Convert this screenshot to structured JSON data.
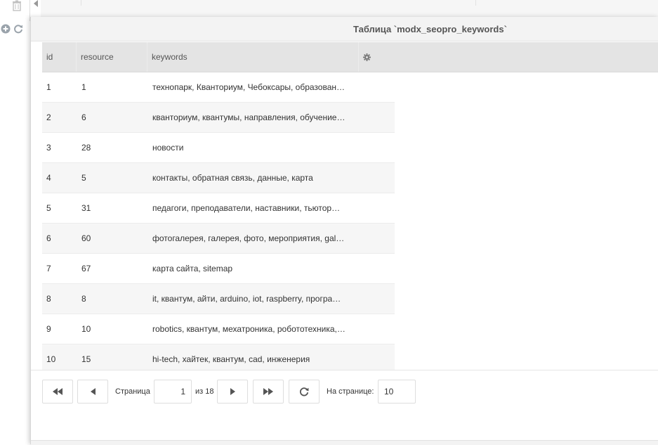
{
  "window": {
    "title": "Таблица `modx_seopro_keywords`"
  },
  "grid": {
    "columns": [
      "id",
      "resource",
      "keywords"
    ],
    "rows": [
      {
        "id": "1",
        "resource": "1",
        "keywords": "технопарк, Кванториум, Чебоксары, образован…"
      },
      {
        "id": "2",
        "resource": "6",
        "keywords": "кванториум, квантумы, направления, обучение…"
      },
      {
        "id": "3",
        "resource": "28",
        "keywords": "новости"
      },
      {
        "id": "4",
        "resource": "5",
        "keywords": "контакты, обратная связь, данные, карта"
      },
      {
        "id": "5",
        "resource": "31",
        "keywords": "педагоги, преподаватели, наставники, тьютор…"
      },
      {
        "id": "6",
        "resource": "60",
        "keywords": "фотогалерея, галерея, фото, мероприятия, gal…"
      },
      {
        "id": "7",
        "resource": "67",
        "keywords": "карта сайта, sitemap"
      },
      {
        "id": "8",
        "resource": "8",
        "keywords": "it, квантум, айти, arduino, iot, raspberry, програ…"
      },
      {
        "id": "9",
        "resource": "10",
        "keywords": "robotics, квантум, мехатроника, робототехника,…"
      },
      {
        "id": "10",
        "resource": "15",
        "keywords": "hi-tech, хайтек, квантум, cad, инженерия"
      }
    ]
  },
  "pager": {
    "page_label": "Страница",
    "page_value": "1",
    "of_label": "из 18",
    "per_page_label": "На странице:",
    "per_page_value": "10"
  },
  "icons": {
    "first": "double-chevron-left-icon",
    "prev": "triangle-left-icon",
    "next": "triangle-right-icon",
    "last": "double-chevron-right-icon",
    "refresh": "refresh-icon",
    "settings": "gear-icon"
  },
  "colors": {
    "header_bg": "#e4e4e4",
    "row_alt_bg": "#f6f6f6",
    "window_header_bg": "#f3f3f3"
  }
}
